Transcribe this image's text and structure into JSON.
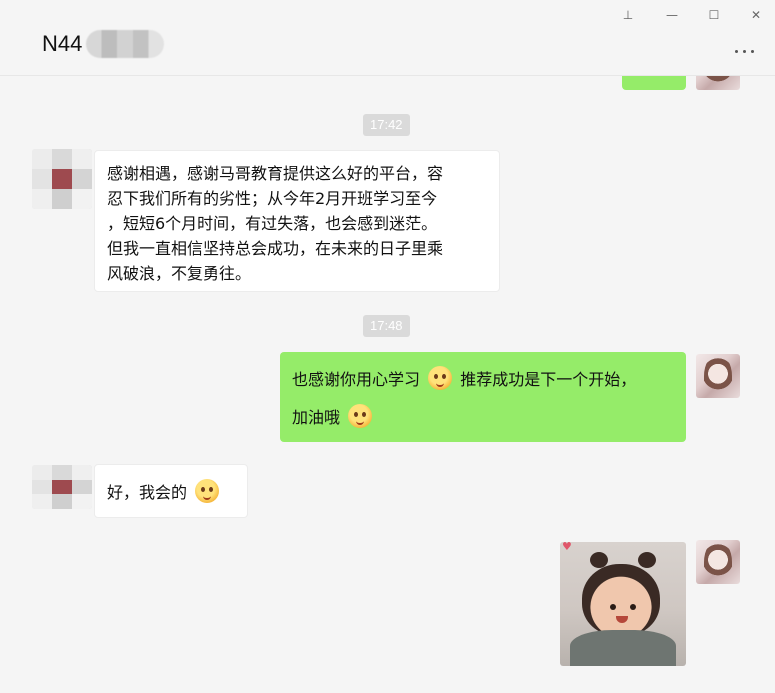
{
  "window": {
    "title": "N44",
    "controls": {
      "pin": "⊥",
      "minimize": "—",
      "maximize": "☐",
      "close": "✕"
    }
  },
  "messages": {
    "time1": "17:42",
    "msg1": "感谢相遇，感谢马哥教育提供这么好的平台，容忍下我们所有的劣性；从今年2月开班学习至今，短短6个月时间，有过失落，也会感到迷茫。但我一直相信坚持总会成功，在未来的日子里乘风破浪，不复勇往。",
    "msg1_lines": [
      "感谢相遇，感谢马哥教育提供这么好的平台，容",
      "忍下我们所有的劣性；从今年2月开班学习至今",
      "，短短6个月时间，有过失落，也会感到迷茫。",
      "但我一直相信坚持总会成功，在未来的日子里乘",
      "风破浪，不复勇往。"
    ],
    "time2": "17:48",
    "msg2_a": "也感谢你用心学习",
    "msg2_b": "推荐成功是下一个开始，",
    "msg2_c": "加油哦",
    "msg3": "好，我会的"
  },
  "icons": [
    "pin-icon",
    "minimize-icon",
    "maximize-icon",
    "close-icon",
    "more-icon",
    "emoji-icon",
    "heart-icon"
  ],
  "colors": {
    "sent_bubble": "#95ec69",
    "received_bubble": "#ffffff",
    "background": "#f5f5f5",
    "time_badge": "#dadada"
  }
}
